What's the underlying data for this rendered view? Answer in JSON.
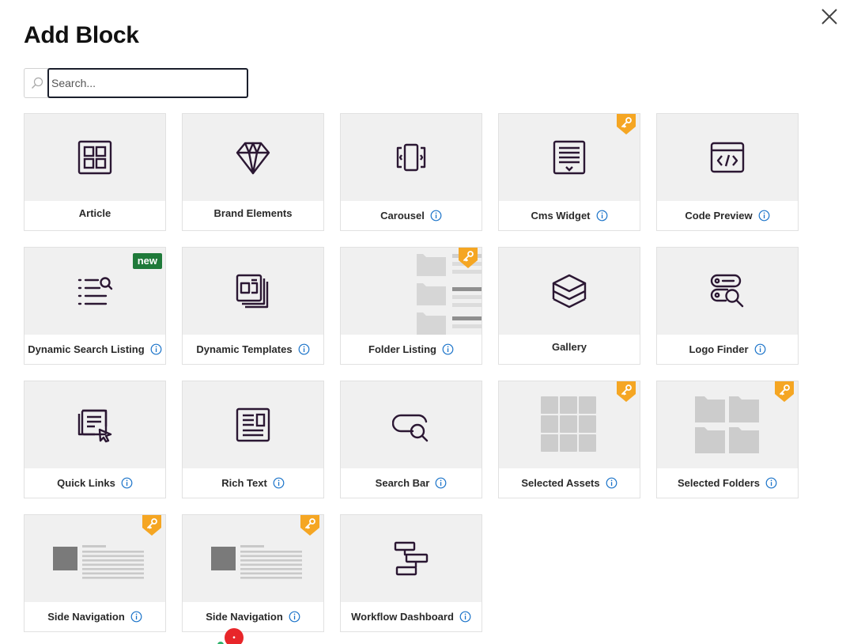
{
  "dialog": {
    "title": "Add Block",
    "close_icon": "close-icon"
  },
  "search": {
    "placeholder": "Search...",
    "value": "",
    "icon": "search-icon"
  },
  "colors": {
    "icon_stroke": "#2b1733",
    "pro_badge": "#f5a623",
    "new_badge": "#1f7a3a",
    "info_icon": "#1a73c9",
    "thumb_bg": "#f0f0f0"
  },
  "blocks": [
    {
      "label": "Article",
      "icon": "article-icon",
      "info": false,
      "pro": false
    },
    {
      "label": "Brand Elements",
      "icon": "diamond-icon",
      "info": false,
      "pro": false
    },
    {
      "label": "Carousel",
      "icon": "carousel-icon",
      "info": true,
      "pro": false
    },
    {
      "label": "Cms Widget",
      "icon": "cms-widget-icon",
      "info": true,
      "pro": true
    },
    {
      "label": "Code Preview",
      "icon": "code-preview-icon",
      "info": true,
      "pro": false
    },
    {
      "label": "Dynamic Search Listing",
      "icon": "search-listing-icon",
      "info": true,
      "pro": false,
      "badge": "new"
    },
    {
      "label": "Dynamic Templates",
      "icon": "templates-icon",
      "info": true,
      "pro": false
    },
    {
      "label": "Folder Listing",
      "icon": "folder-listing-preview",
      "info": true,
      "pro": true
    },
    {
      "label": "Gallery",
      "icon": "layers-icon",
      "info": false,
      "pro": false
    },
    {
      "label": "Logo Finder",
      "icon": "logo-finder-icon",
      "info": true,
      "pro": false
    },
    {
      "label": "Quick Links",
      "icon": "quick-links-icon",
      "info": true,
      "pro": false
    },
    {
      "label": "Rich Text",
      "icon": "rich-text-icon",
      "info": true,
      "pro": false
    },
    {
      "label": "Search Bar",
      "icon": "search-bar-icon",
      "info": true,
      "pro": false
    },
    {
      "label": "Selected Assets",
      "icon": "assets-grid-preview",
      "info": true,
      "pro": true
    },
    {
      "label": "Selected Folders",
      "icon": "folders-grid-preview",
      "info": true,
      "pro": true
    },
    {
      "label": "Side Navigation",
      "icon": "side-navigation-preview",
      "info": true,
      "pro": true
    },
    {
      "label": "Side Navigation",
      "icon": "side-navigation-preview",
      "info": true,
      "pro": true
    },
    {
      "label": "Workflow Dashboard",
      "icon": "workflow-icon",
      "info": true,
      "pro": false
    }
  ]
}
